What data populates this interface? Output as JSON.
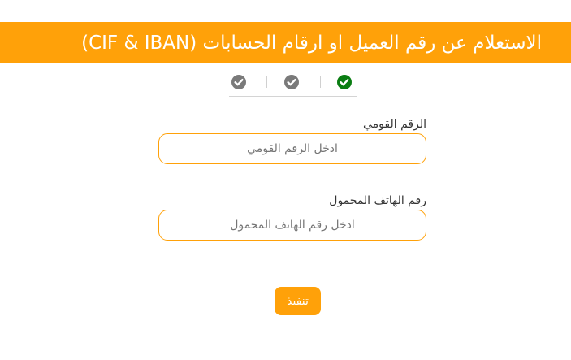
{
  "header": {
    "title": "الاستعلام عن رقم العميل او ارقام الحسابات (CIF & IBAN)"
  },
  "steps": [
    {
      "icon": "check-circle-icon",
      "state": "completed",
      "color": "#7a7a7a"
    },
    {
      "icon": "check-circle-icon",
      "state": "completed",
      "color": "#7a7a7a"
    },
    {
      "icon": "check-circle-icon",
      "state": "current",
      "color": "#0a7d12"
    }
  ],
  "form": {
    "national_id": {
      "label": "الرقم القومي",
      "placeholder": "ادخل الرقم القومي",
      "value": ""
    },
    "mobile": {
      "label": "رقم الهاتف المحمول",
      "placeholder": "ادخل رقم الهاتف المحمول",
      "value": ""
    },
    "submit_label": "تنفيذ"
  },
  "colors": {
    "accent": "#FFA109",
    "step_done": "#7a7a7a",
    "step_current": "#0a7d12"
  }
}
